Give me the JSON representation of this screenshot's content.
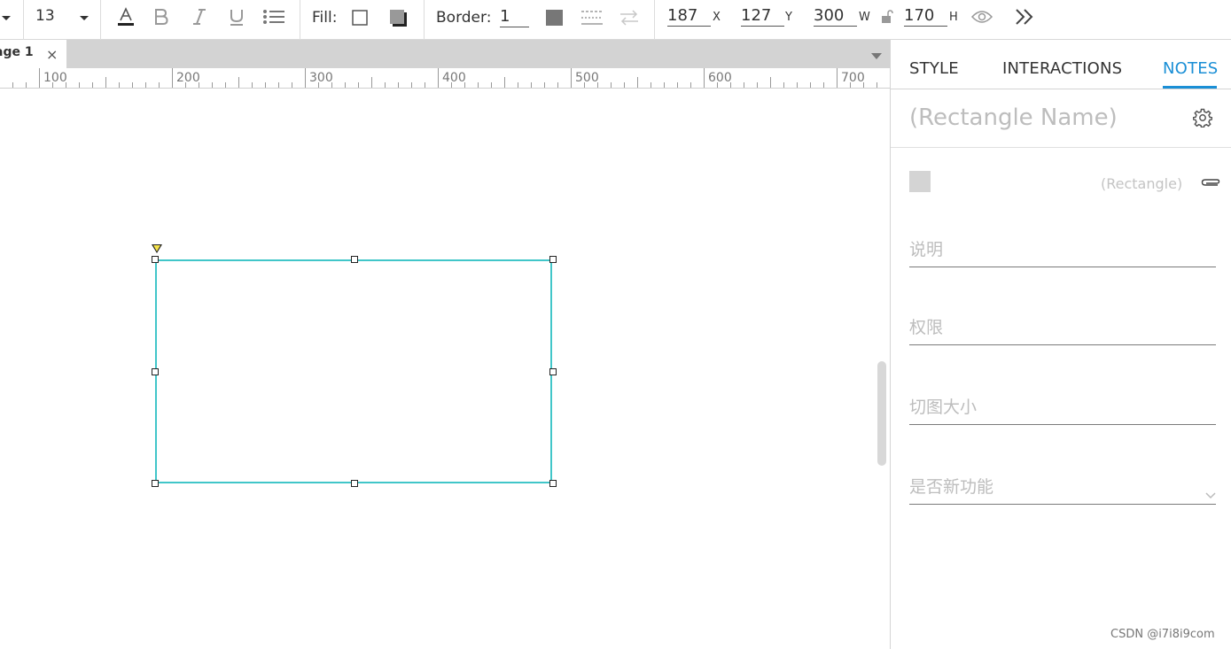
{
  "toolbar": {
    "font_size": "13",
    "fill_label": "Fill:",
    "border_label": "Border:",
    "border_width": "1",
    "x_value": "187",
    "x_label": "X",
    "y_value": "127",
    "y_label": "Y",
    "w_value": "300",
    "w_label": "W",
    "h_value": "170",
    "h_label": "H"
  },
  "page_tab": {
    "label": "age 1",
    "close": "×"
  },
  "ruler": {
    "labels": [
      "100",
      "200",
      "300",
      "400",
      "500",
      "600",
      "700"
    ]
  },
  "panel": {
    "tabs": [
      "STYLE",
      "INTERACTIONS",
      "NOTES"
    ],
    "active_tab": "NOTES",
    "name_placeholder": "(Rectangle Name)",
    "shape_type": "(Rectangle)",
    "fields": [
      "说明",
      "权限",
      "切图大小",
      "是否新功能"
    ]
  },
  "watermark": "CSDN @i7i8i9com",
  "colors": {
    "accent": "#1a8fd6",
    "selection": "#41c6c9",
    "rotate_marker": "#f5e34a"
  }
}
